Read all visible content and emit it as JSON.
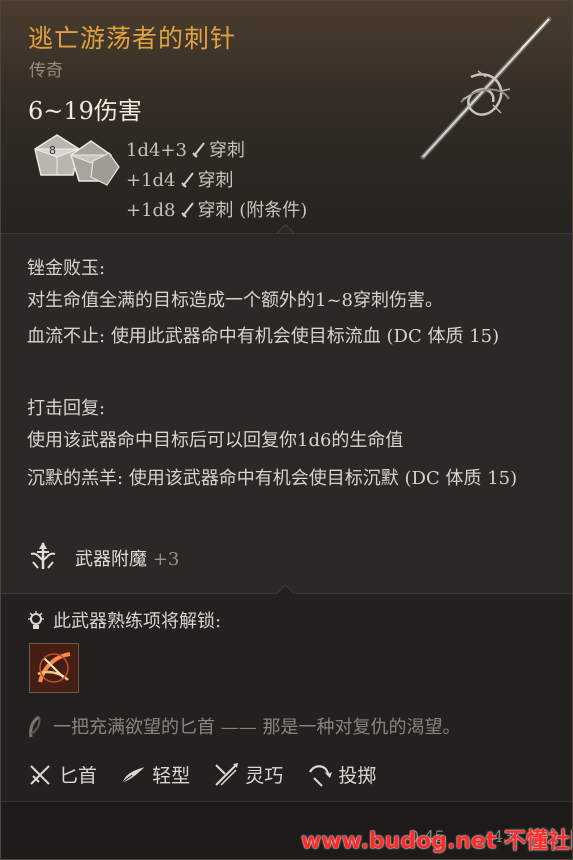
{
  "item": {
    "name": "逃亡游荡者的刺针",
    "rarity": "传奇",
    "damage_range": "6~19伤害",
    "damage_lines": [
      {
        "dice": "1d4+3",
        "type": "穿刺"
      },
      {
        "dice": "+1d4",
        "type": "穿刺"
      },
      {
        "dice": "+1d8",
        "type": "穿刺 (附条件)"
      }
    ]
  },
  "passives": [
    {
      "label": "锉金败玉:",
      "text": "对生命值全满的目标造成一个额外的1~8穿刺伤害。"
    },
    {
      "label": "血流不止:",
      "text": "使用此武器命中有机会使目标流血 (DC 体质 15)"
    },
    {
      "label": "打击回复:",
      "text": "使用该武器命中目标后可以回复你1d6的生命值"
    },
    {
      "label": "沉默的羔羊:",
      "text": "使用该武器命中有机会使目标沉默 (DC 体质 15)"
    }
  ],
  "enchantment": {
    "label": "武器附魔",
    "value": "+3"
  },
  "proficiency_unlock": "此武器熟练项将解锁:",
  "flavor_text": "一把充满欲望的匕首 —— 那是一种对复仇的渴望。",
  "properties": [
    {
      "label": "匕首",
      "icon": "dagger-icon"
    },
    {
      "label": "轻型",
      "icon": "feather-icon"
    },
    {
      "label": "灵巧",
      "icon": "finesse-icon"
    },
    {
      "label": "投掷",
      "icon": "thrown-icon"
    }
  ],
  "footer": {
    "weight": "0.45",
    "price": "43"
  },
  "watermark": "www.budog.net 不懂社区",
  "colors": {
    "title": "#e0a23e",
    "watermark": "#ff2a2a"
  }
}
